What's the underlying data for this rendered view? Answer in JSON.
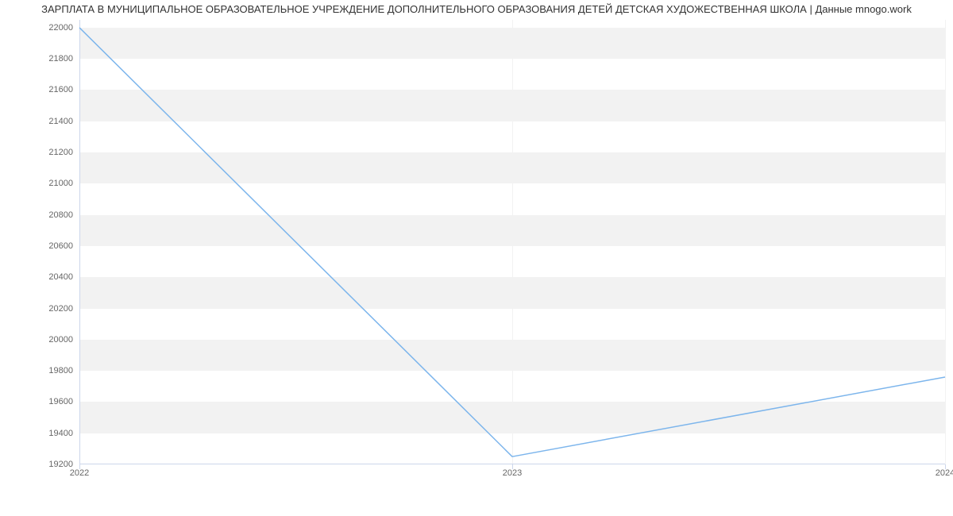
{
  "chart_data": {
    "type": "line",
    "title": "ЗАРПЛАТА В МУНИЦИПАЛЬНОЕ ОБРАЗОВАТЕЛЬНОЕ УЧРЕЖДЕНИЕ ДОПОЛНИТЕЛЬНОГО ОБРАЗОВАНИЯ ДЕТЕЙ ДЕТСКАЯ ХУДОЖЕСТВЕННАЯ ШКОЛА | Данные mnogo.work",
    "xlabel": "",
    "ylabel": "",
    "categories": [
      "2022",
      "2023",
      "2024"
    ],
    "values": [
      22000,
      19250,
      19760
    ],
    "x_ticks": [
      "2022",
      "2023",
      "2024"
    ],
    "y_ticks": [
      19200,
      19400,
      19600,
      19800,
      20000,
      20200,
      20400,
      20600,
      20800,
      21000,
      21200,
      21400,
      21600,
      21800,
      22000
    ],
    "ylim": [
      19200,
      22050
    ],
    "line_color": "#7cb5ec",
    "band_color": "#f2f2f2"
  }
}
